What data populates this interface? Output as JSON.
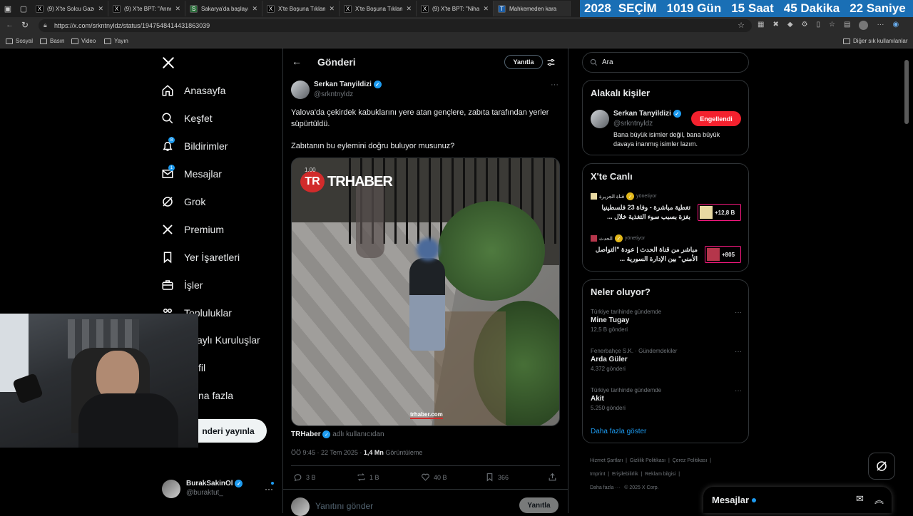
{
  "browser": {
    "tabs": [
      {
        "icon": "X",
        "label": "(9) X'te Solcu Gaze"
      },
      {
        "icon": "X",
        "label": "(9) X'te BPT: \"Anne"
      },
      {
        "icon": "S",
        "label": "Sakarya'da başlaya"
      },
      {
        "icon": "X",
        "label": "X'te Boşuna Tıklam"
      },
      {
        "icon": "X",
        "label": "X'te Boşuna Tıklam"
      },
      {
        "icon": "X",
        "label": "(9) X'te BPT: \"Niha"
      },
      {
        "icon": "T",
        "label": "Mahkemeden kara"
      }
    ],
    "countdown": {
      "year": "2028",
      "word": "SEÇİM",
      "days": "1019 Gün",
      "hours": "15 Saat",
      "minutes": "45 Dakika",
      "seconds": "22 Saniye"
    },
    "url": "https://x.com/srkntnyldz/status/1947548414431863039",
    "bookmarks": [
      "Sosyal",
      "Basın",
      "Video",
      "Yayın"
    ],
    "other_bookmarks": "Diğer sık kullanılanlar"
  },
  "nav": {
    "items": [
      {
        "label": "Anasayfa"
      },
      {
        "label": "Keşfet"
      },
      {
        "label": "Bildirimler",
        "badge": "8"
      },
      {
        "label": "Mesajlar",
        "badge": "1"
      },
      {
        "label": "Grok"
      },
      {
        "label": "Premium"
      },
      {
        "label": "Yer İşaretleri"
      },
      {
        "label": "İşler"
      },
      {
        "label": "Topluluklar"
      },
      {
        "label": "aylı Kuruluşlar"
      },
      {
        "label": "fil"
      },
      {
        "label": "na fazla"
      }
    ],
    "post_button": "nderi yayınla",
    "account": {
      "name": "BurakSakinOl",
      "handle": "@buraktut_"
    }
  },
  "post": {
    "header_title": "Gönderi",
    "reply_button": "Yanıtla",
    "author": {
      "name": "Serkan Tanyildizi",
      "handle": "@srkntnyldz"
    },
    "text1": "Yalova'da çekirdek kabuklarını yere atan gençlere, zabıta tarafından yerler süpürtüldü.",
    "text2": "Zabıtanın bu eylemini doğru buluyor musunuz?",
    "video": {
      "logo": "TRHABER",
      "speed": "1.00",
      "watermark": "trhaber.com"
    },
    "source": {
      "name": "TRHaber",
      "suffix": "adlı kullanıcıdan"
    },
    "meta": {
      "time": "ÖÖ 9:45 · 22 Tem 2025 · ",
      "views": "1,4 Mn",
      "views_label": " Görüntüleme"
    },
    "stats": {
      "replies": "3 B",
      "reposts": "1 B",
      "likes": "40 B",
      "bookmarks": "366"
    },
    "reply_placeholder": "Yanıtını gönder",
    "reply_submit": "Yanıtla"
  },
  "right": {
    "search_placeholder": "Ara",
    "related": {
      "title": "Alakalı kişiler",
      "name": "Serkan Tanyildizi",
      "handle": "@srkntnyldz",
      "button": "Engellendi",
      "bio": "Bana büyük isimler değil, bana büyük davaya inanmış isimler lazım."
    },
    "live": {
      "title": "X'te Canlı",
      "items": [
        {
          "host": "قناة الجزيرة",
          "role": "yönetiyor",
          "title": "تغطية مباشرة - وفاة 23 فلسطينيا بغزة بسبب سوء التغذية خلال ...",
          "count": "+12,8 B"
        },
        {
          "host": "الحدث",
          "role": "yönetiyor",
          "title": "مباشر من قناة الحدث | عودة \"التواصل الأمني\" بين الإدارة السورية ...",
          "count": "+805"
        }
      ]
    },
    "trends": {
      "title": "Neler oluyor?",
      "items": [
        {
          "category": "Türkiye tarihinde gündemde",
          "name": "Mine Tugay",
          "count": "12,5 B gönderi"
        },
        {
          "category": "Fenerbahçe S.K. · Gündemdekiler",
          "name": "Arda Güler",
          "count": "4.372 gönderi"
        },
        {
          "category": "Türkiye tarihinde gündemde",
          "name": "Akit",
          "count": "5.250 gönderi"
        }
      ],
      "more": "Daha fazla göster"
    },
    "footer": [
      "Hizmet Şartları",
      "Gizlilik Politikası",
      "Çerez Politikası",
      "Imprint",
      "Erişilebilirlik",
      "Reklam bilgisi",
      "Daha fazla ···",
      "© 2025 X Corp."
    ],
    "messages": "Mesajlar"
  }
}
